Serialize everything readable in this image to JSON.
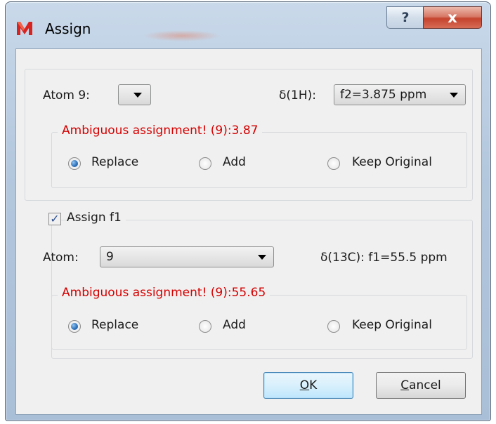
{
  "window": {
    "title": "Assign",
    "help_label": "?",
    "close_label": "x"
  },
  "f2_section": {
    "atom_label": "Atom 9:",
    "atom_value": "",
    "shift_label": "δ(1H):",
    "shift_value": "f2=3.875 ppm",
    "ambiguous_text": "Ambiguous assignment! (9):3.87",
    "options": [
      "Replace",
      "Add",
      "Keep Original"
    ],
    "selected": "Replace"
  },
  "f1_section": {
    "assign_label": "Assign f1",
    "assign_checked": true,
    "atom_label": "Atom:",
    "atom_value": "9",
    "shift_text": "δ(13C): f1=55.5 ppm",
    "ambiguous_text": "Ambiguous assignment! (9):55.65",
    "options": [
      "Replace",
      "Add",
      "Keep Original"
    ],
    "selected": "Replace"
  },
  "buttons": {
    "ok_underlined": "O",
    "ok_rest": "K",
    "cancel_underlined": "C",
    "cancel_rest": "ancel"
  },
  "colors": {
    "warning": "#d50000",
    "accent": "#2a6db6"
  },
  "icons": {
    "app": "app-logo-icon",
    "help": "help-icon",
    "close": "close-icon",
    "dropdown": "chevron-down-icon",
    "check": "checkmark-icon"
  }
}
